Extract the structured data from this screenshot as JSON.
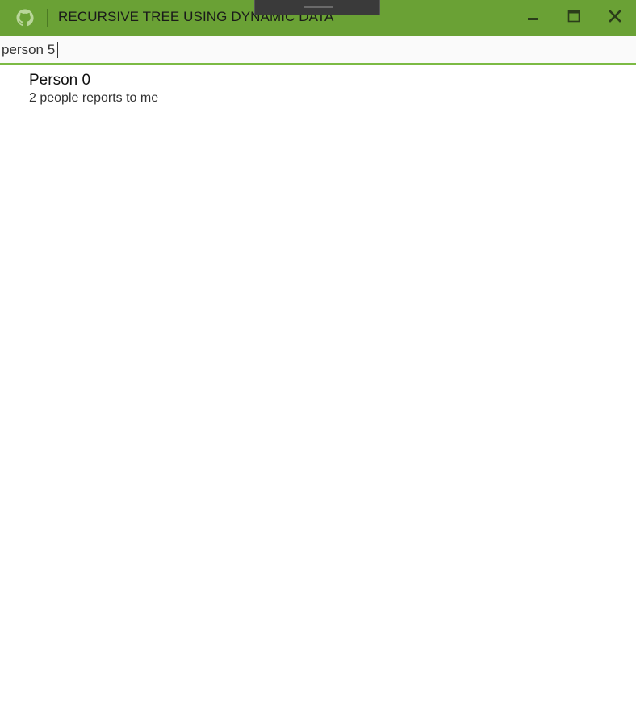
{
  "window": {
    "title": "RECURSIVE TREE USING DYNAMIC DATA",
    "app_icon": "github-octocat-icon",
    "controls": {
      "minimize_icon": "minimize-icon",
      "maximize_icon": "maximize-icon",
      "close_icon": "close-icon"
    },
    "colors": {
      "titlebar": "#6aa135",
      "accent": "#7cba44"
    }
  },
  "search": {
    "value": "person 5"
  },
  "tree": {
    "items": [
      {
        "name": "Person 0",
        "subtitle": "2 people reports to me"
      }
    ]
  }
}
